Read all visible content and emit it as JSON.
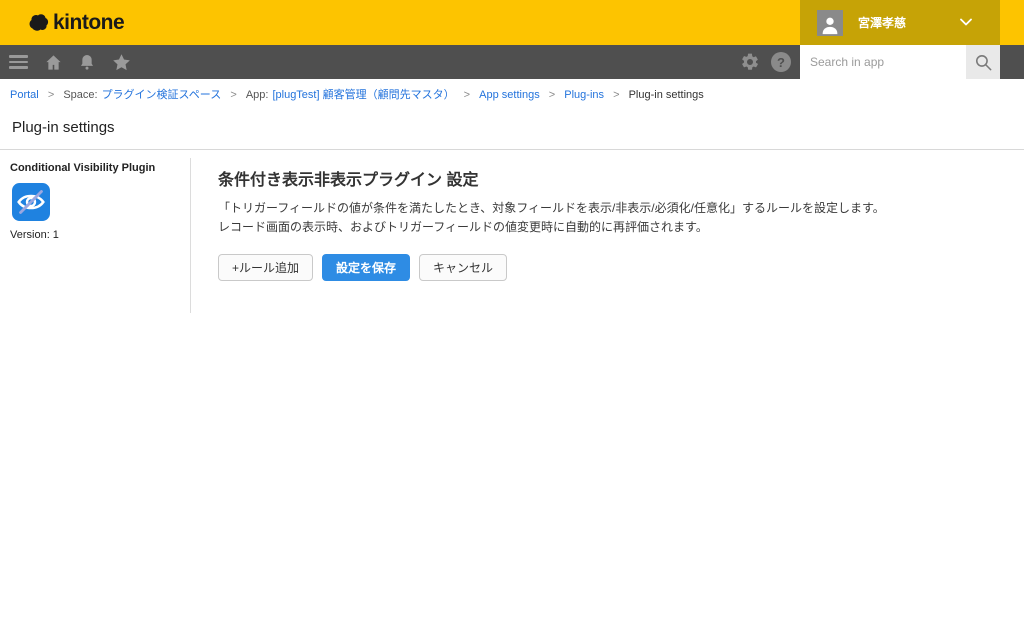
{
  "header": {
    "logo_text": "kintone",
    "user_name": "宮澤孝慈"
  },
  "toolbar": {
    "search_placeholder": "Search in app",
    "help_glyph": "?"
  },
  "breadcrumb": {
    "separator": ">",
    "items": [
      {
        "label": "Portal"
      },
      {
        "prefix": "Space:",
        "label": "プラグイン検証スペース"
      },
      {
        "prefix": "App:",
        "label": "[plugTest] 顧客管理（顧問先マスタ）"
      },
      {
        "label": "App settings"
      },
      {
        "label": "Plug-ins"
      },
      {
        "label": "Plug-in settings"
      }
    ]
  },
  "page": {
    "title": "Plug-in settings"
  },
  "sidebar": {
    "plugin_name": "Conditional Visibility Plugin",
    "version": "Version: 1"
  },
  "main": {
    "heading": "条件付き表示非表示プラグイン 設定",
    "description_line1": "「トリガーフィールドの値が条件を満たしたとき、対象フィールドを表示/非表示/必須化/任意化」するルールを設定します。",
    "description_line2": "レコード画面の表示時、およびトリガーフィールドの値変更時に自動的に再評価されます。",
    "buttons": {
      "add_rule": "+ルール追加",
      "save": "設定を保存",
      "cancel": "キャンセル"
    }
  },
  "colors": {
    "brand_yellow": "#FDC400",
    "user_box_gold": "#C6A306",
    "toolbar_gray": "#4F4F4F",
    "link_blue": "#2373DC",
    "primary_button_blue": "#2E8CE4",
    "plugin_icon_blue": "#1F82E0"
  }
}
